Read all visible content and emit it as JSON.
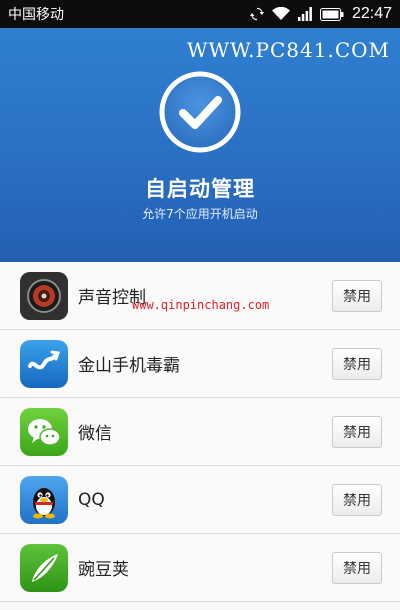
{
  "status_bar": {
    "carrier": "中国移动",
    "time": "22:47",
    "icons": [
      "sync-icon",
      "wifi-icon",
      "signal-icon",
      "battery-icon"
    ]
  },
  "header": {
    "watermark": "WWW.PC841.COM",
    "icon": "check-circle-icon",
    "title": "自启动管理",
    "subtitle": "允许7个应用开机启动",
    "colors": {
      "bg_top": "#2f7fd0",
      "bg_bottom": "#235fb3"
    }
  },
  "watermark_mid": "www.qinpinchang.com",
  "apps": [
    {
      "name": "声音控制",
      "button": "禁用",
      "icon": "speaker-icon"
    },
    {
      "name": "金山手机毒霸",
      "button": "禁用",
      "icon": "duba-icon"
    },
    {
      "name": "微信",
      "button": "禁用",
      "icon": "wechat-icon"
    },
    {
      "name": "QQ",
      "button": "禁用",
      "icon": "qq-penguin-icon"
    },
    {
      "name": "豌豆荚",
      "button": "禁用",
      "icon": "wandoujia-icon"
    }
  ]
}
